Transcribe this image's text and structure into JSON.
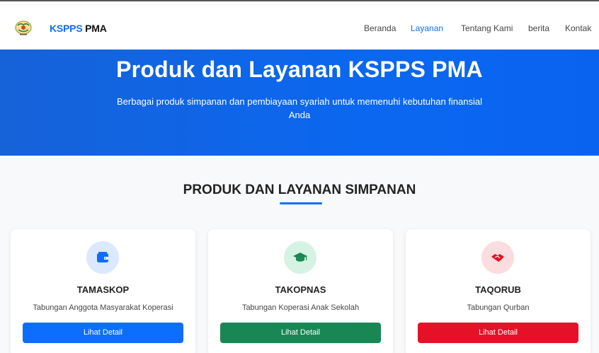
{
  "navbar": {
    "brand_part1": "KSPPS",
    "brand_part2": " PMA",
    "links": [
      "Beranda",
      "Layanan",
      "Tentang Kami",
      "berita",
      "Kontak"
    ],
    "active_link": "Layanan",
    "accent_color": "#0d6efd"
  },
  "hero": {
    "title": "Produk dan Layanan KSPPS PMA",
    "subtitle": "Berbagai produk simpanan dan pembiayaan syariah untuk memenuhi kebutuhan finansial Anda",
    "background": "#0b67f0"
  },
  "section": {
    "title": "PRODUK DAN LAYANAN SIMPANAN"
  },
  "cards": [
    {
      "title": "TAMASKOP",
      "description": "Tabungan Anggota Masyarakat Koperasi",
      "button": "Lihat Detail",
      "icon": "wallet-icon",
      "color": "#0d6efd",
      "icon_bg": "#dbe8fd"
    },
    {
      "title": "TAKOPNAS",
      "description": "Tabungan Koperasi Anak Sekolah",
      "button": "Lihat Detail",
      "icon": "graduation-cap-icon",
      "color": "#198754",
      "icon_bg": "#d6f2e3"
    },
    {
      "title": "TAQORUB",
      "description": "Tabungan Qurban",
      "button": "Lihat Detail",
      "icon": "handshake-icon",
      "color": "#e51227",
      "icon_bg": "#fbdcdf"
    }
  ]
}
